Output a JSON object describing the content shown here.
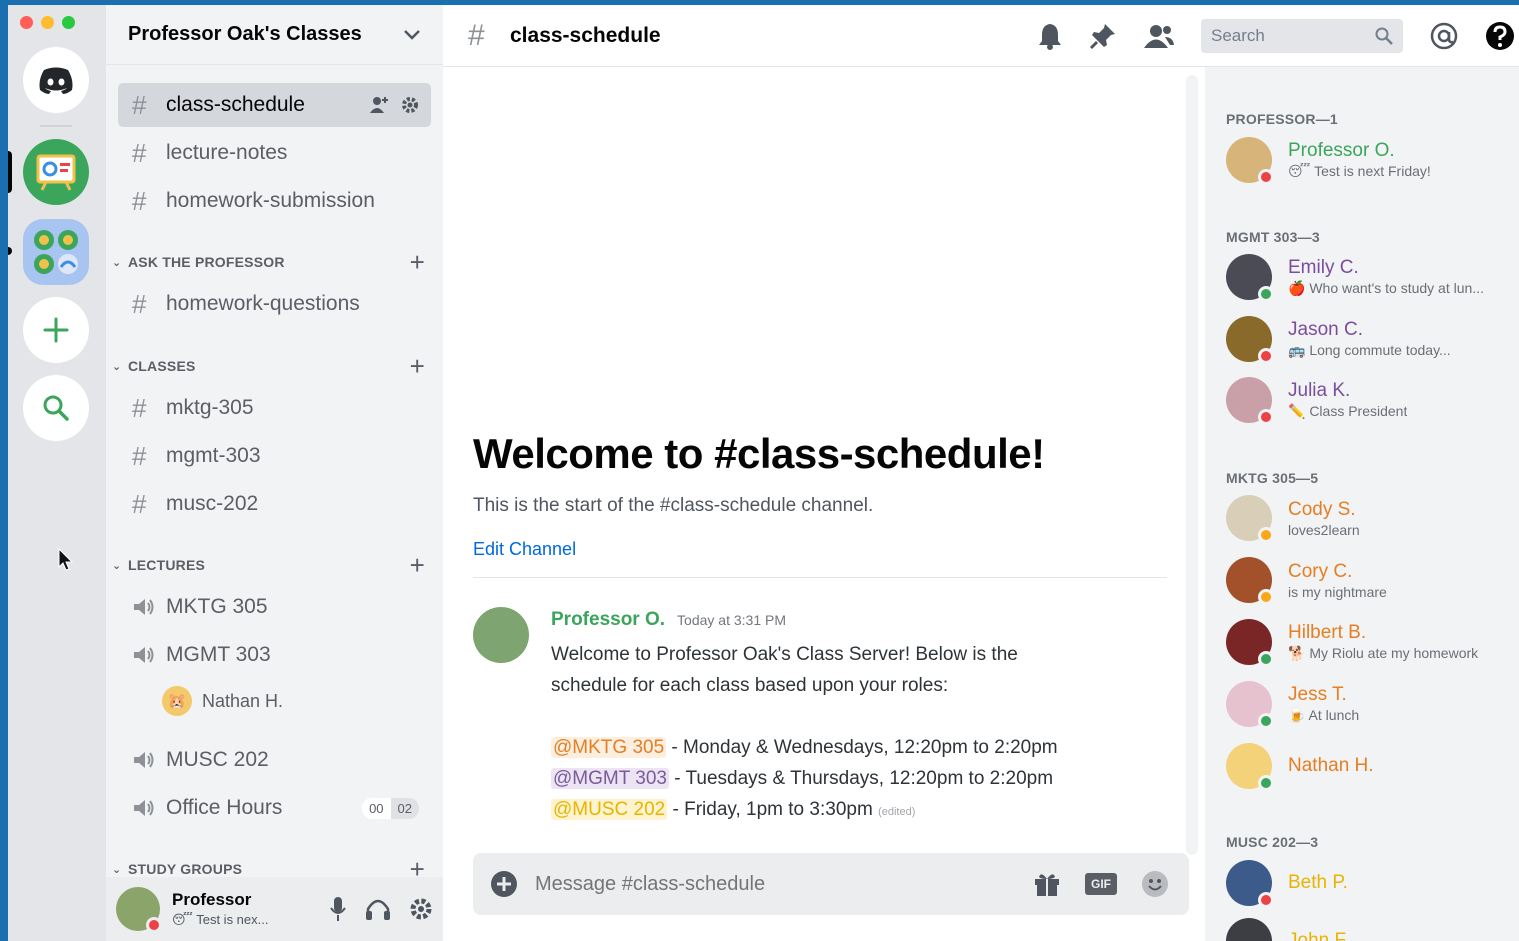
{
  "server": {
    "name": "Professor Oak's Classes"
  },
  "channels": {
    "top": [
      {
        "name": "class-schedule",
        "active": true
      },
      {
        "name": "lecture-notes",
        "active": false
      },
      {
        "name": "homework-submission",
        "active": false
      }
    ],
    "categories": [
      {
        "name": "ASK THE PROFESSOR",
        "channels": [
          "homework-questions"
        ]
      },
      {
        "name": "CLASSES",
        "channels": [
          "mktg-305",
          "mgmt-303",
          "musc-202"
        ]
      },
      {
        "name": "LECTURES",
        "voice": [
          "MKTG 305",
          "MGMT 303",
          "MUSC 202",
          "Office Hours"
        ],
        "voice_user": "Nathan H.",
        "office_hours_count": [
          "00",
          "02"
        ]
      },
      {
        "name": "STUDY GROUPS"
      }
    ]
  },
  "user_panel": {
    "name": "Professor",
    "status": "😴 Test is nex..."
  },
  "header": {
    "channel": "class-schedule",
    "search_placeholder": "Search"
  },
  "welcome": {
    "title": "Welcome to #class-schedule!",
    "subtitle": "This is the start of the #class-schedule channel.",
    "edit_link": "Edit Channel"
  },
  "message": {
    "author": "Professor O.",
    "time": "Today at 3:31 PM",
    "line1": "Welcome to Professor Oak's Class Server! Below is the",
    "line2": "schedule for each class based upon your roles:",
    "schedule": [
      {
        "role": "@MKTG 305",
        "text": " - Monday & Wednesdays, 12:20pm to 2:20pm"
      },
      {
        "role": "@MGMT 303",
        "text": " - Tuesdays & Thursdays, 12:20pm to 2:20pm"
      },
      {
        "role": "@MUSC 202",
        "text": " - Friday, 1pm to 3:30pm",
        "edited": "(edited)"
      }
    ]
  },
  "composer": {
    "placeholder": "Message #class-schedule",
    "gif": "GIF"
  },
  "members": {
    "groups": [
      {
        "title": "PROFESSOR—1",
        "members": [
          {
            "name": "Professor O.",
            "activity": "😴 Test is next Friday!"
          }
        ]
      },
      {
        "title": "MGMT 303—3",
        "members": [
          {
            "name": "Emily C.",
            "activity": "🍎 Who want's to study at lun..."
          },
          {
            "name": "Jason C.",
            "activity": "🚌 Long commute today..."
          },
          {
            "name": "Julia K.",
            "activity": "✏️ Class President"
          }
        ]
      },
      {
        "title": "MKTG 305—5",
        "members": [
          {
            "name": "Cody S.",
            "activity": "loves2learn"
          },
          {
            "name": "Cory C.",
            "activity": "is my nightmare"
          },
          {
            "name": "Hilbert B.",
            "activity": "🐕 My Riolu ate my homework"
          },
          {
            "name": "Jess T.",
            "activity": "🍺 At lunch"
          },
          {
            "name": "Nathan H.",
            "activity": ""
          }
        ]
      },
      {
        "title": "MUSC 202—3",
        "members": [
          {
            "name": "Beth P.",
            "activity": ""
          },
          {
            "name": "John F.",
            "activity": ""
          }
        ]
      }
    ]
  },
  "colors": {
    "professor": "#3ba55c",
    "mgmt": "#7a4e9c",
    "mktg": "#e67e22",
    "musc": "#e8b400"
  }
}
